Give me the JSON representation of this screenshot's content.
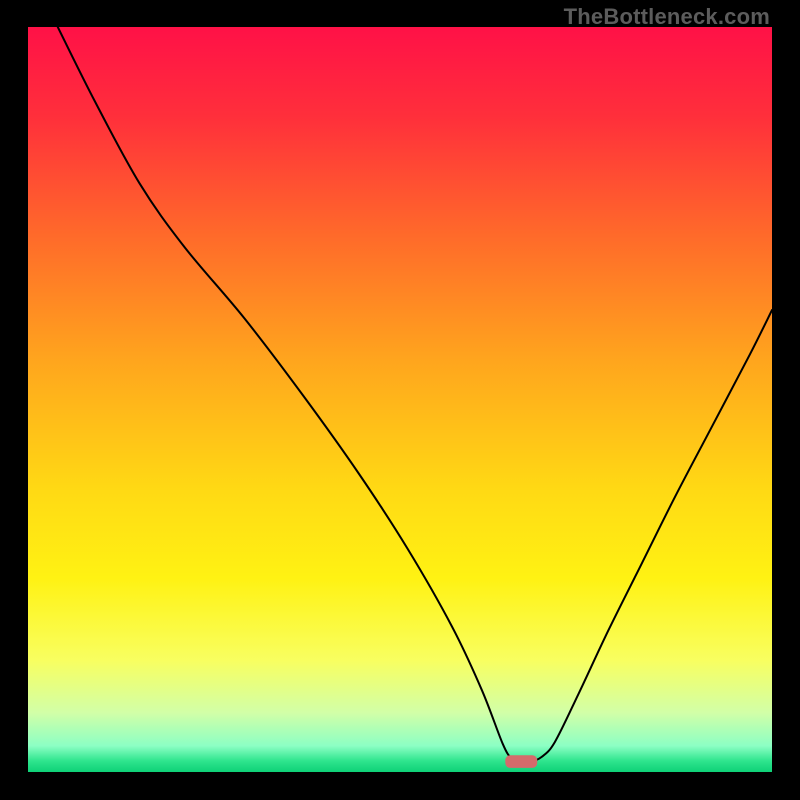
{
  "watermark": "TheBottleneck.com",
  "chart_data": {
    "type": "line",
    "title": "",
    "xlabel": "",
    "ylabel": "",
    "xlim": [
      0,
      100
    ],
    "ylim": [
      0,
      100
    ],
    "curve": {
      "name": "bottleneck-curve",
      "points": [
        {
          "x": 4.0,
          "y": 100.0
        },
        {
          "x": 9.0,
          "y": 90.0
        },
        {
          "x": 15.0,
          "y": 79.0
        },
        {
          "x": 21.0,
          "y": 70.5
        },
        {
          "x": 29.0,
          "y": 61.0
        },
        {
          "x": 37.0,
          "y": 50.5
        },
        {
          "x": 44.5,
          "y": 40.0
        },
        {
          "x": 51.0,
          "y": 30.0
        },
        {
          "x": 57.0,
          "y": 19.5
        },
        {
          "x": 61.0,
          "y": 11.0
        },
        {
          "x": 63.8,
          "y": 3.8
        },
        {
          "x": 65.0,
          "y": 1.8
        },
        {
          "x": 66.0,
          "y": 1.4
        },
        {
          "x": 67.5,
          "y": 1.4
        },
        {
          "x": 69.0,
          "y": 2.0
        },
        {
          "x": 70.8,
          "y": 4.0
        },
        {
          "x": 74.0,
          "y": 10.5
        },
        {
          "x": 78.0,
          "y": 19.0
        },
        {
          "x": 82.5,
          "y": 28.0
        },
        {
          "x": 87.0,
          "y": 37.0
        },
        {
          "x": 92.0,
          "y": 46.5
        },
        {
          "x": 97.0,
          "y": 56.0
        },
        {
          "x": 100.0,
          "y": 62.0
        }
      ]
    },
    "marker": {
      "x": 66.3,
      "y": 1.4,
      "width": 4.3,
      "height": 1.7,
      "fill": "#d46b6b"
    },
    "background": {
      "gradient_stops": [
        {
          "offset": 0.0,
          "color": "#ff1147"
        },
        {
          "offset": 0.12,
          "color": "#ff2f3b"
        },
        {
          "offset": 0.28,
          "color": "#ff6a2a"
        },
        {
          "offset": 0.45,
          "color": "#ffa61d"
        },
        {
          "offset": 0.62,
          "color": "#ffd914"
        },
        {
          "offset": 0.74,
          "color": "#fff213"
        },
        {
          "offset": 0.85,
          "color": "#f8ff60"
        },
        {
          "offset": 0.92,
          "color": "#d2ffa7"
        },
        {
          "offset": 0.965,
          "color": "#8cffc4"
        },
        {
          "offset": 0.985,
          "color": "#2fe58e"
        },
        {
          "offset": 1.0,
          "color": "#0ed177"
        }
      ]
    }
  }
}
